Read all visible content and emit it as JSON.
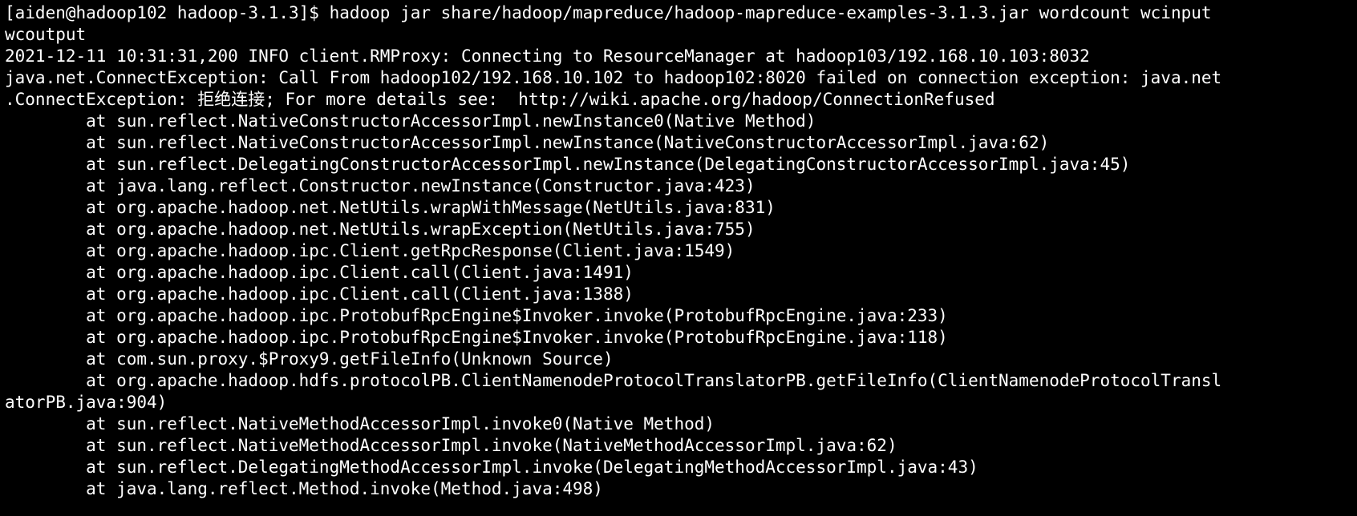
{
  "terminal": {
    "background": "#000000",
    "foreground": "#ffffff",
    "lines": [
      "[aiden@hadoop102 hadoop-3.1.3]$ hadoop jar share/hadoop/mapreduce/hadoop-mapreduce-examples-3.1.3.jar wordcount wcinput",
      "wcoutput",
      "2021-12-11 10:31:31,200 INFO client.RMProxy: Connecting to ResourceManager at hadoop103/192.168.10.103:8032",
      "java.net.ConnectException: Call From hadoop102/192.168.10.102 to hadoop102:8020 failed on connection exception: java.net",
      ".ConnectException: 拒绝连接; For more details see:  http://wiki.apache.org/hadoop/ConnectionRefused",
      "        at sun.reflect.NativeConstructorAccessorImpl.newInstance0(Native Method)",
      "        at sun.reflect.NativeConstructorAccessorImpl.newInstance(NativeConstructorAccessorImpl.java:62)",
      "        at sun.reflect.DelegatingConstructorAccessorImpl.newInstance(DelegatingConstructorAccessorImpl.java:45)",
      "        at java.lang.reflect.Constructor.newInstance(Constructor.java:423)",
      "        at org.apache.hadoop.net.NetUtils.wrapWithMessage(NetUtils.java:831)",
      "        at org.apache.hadoop.net.NetUtils.wrapException(NetUtils.java:755)",
      "        at org.apache.hadoop.ipc.Client.getRpcResponse(Client.java:1549)",
      "        at org.apache.hadoop.ipc.Client.call(Client.java:1491)",
      "        at org.apache.hadoop.ipc.Client.call(Client.java:1388)",
      "        at org.apache.hadoop.ipc.ProtobufRpcEngine$Invoker.invoke(ProtobufRpcEngine.java:233)",
      "        at org.apache.hadoop.ipc.ProtobufRpcEngine$Invoker.invoke(ProtobufRpcEngine.java:118)",
      "        at com.sun.proxy.$Proxy9.getFileInfo(Unknown Source)",
      "        at org.apache.hadoop.hdfs.protocolPB.ClientNamenodeProtocolTranslatorPB.getFileInfo(ClientNamenodeProtocolTransl",
      "atorPB.java:904)",
      "        at sun.reflect.NativeMethodAccessorImpl.invoke0(Native Method)",
      "        at sun.reflect.NativeMethodAccessorImpl.invoke(NativeMethodAccessorImpl.java:62)",
      "        at sun.reflect.DelegatingMethodAccessorImpl.invoke(DelegatingMethodAccessorImpl.java:43)",
      "        at java.lang.reflect.Method.invoke(Method.java:498)"
    ]
  }
}
